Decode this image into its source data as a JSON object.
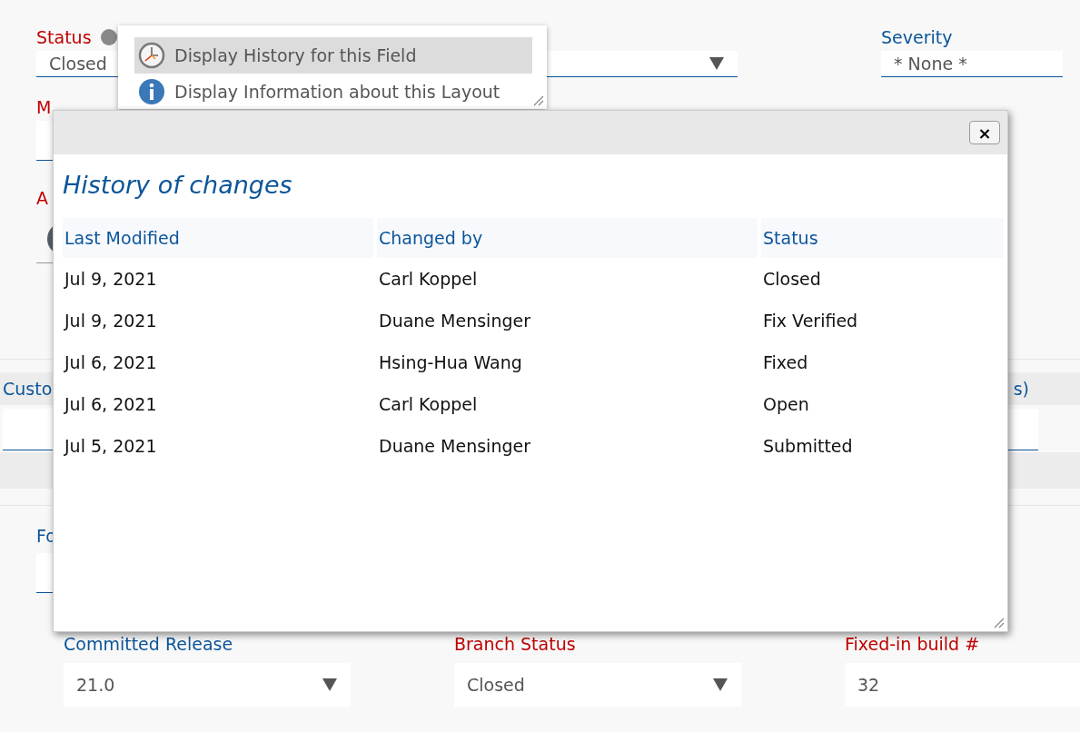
{
  "form": {
    "status": {
      "label": "Status",
      "value": "Closed",
      "required": true
    },
    "severity": {
      "label": "Severity",
      "value": "* None *",
      "required": false
    },
    "field_2": {
      "label": "M",
      "required": true
    },
    "field_3": {
      "label": "A",
      "required": true
    },
    "section": {
      "label": "Custo",
      "label_right": "s)"
    },
    "field_4": {
      "label": "Fo",
      "required": false
    },
    "bottom_fields": [
      {
        "label": "Committed Release",
        "value": "21.0",
        "kind": "dropdown",
        "required": false
      },
      {
        "label": "Branch Status",
        "value": "Closed",
        "kind": "dropdown",
        "required": true
      },
      {
        "label": "Fixed-in build #",
        "value": "32",
        "kind": "text",
        "required": true
      }
    ]
  },
  "context_menu": {
    "items": [
      {
        "label": "Display History for this Field",
        "kind": "history",
        "selected": true
      },
      {
        "label": "Display Information about this Layout",
        "kind": "info",
        "selected": false
      }
    ]
  },
  "dialog": {
    "close": "×",
    "title": "History of changes",
    "columns": [
      "Last Modified",
      "Changed by",
      "Status"
    ],
    "rows": [
      [
        "Jul 9, 2021",
        "Carl Koppel",
        "Closed"
      ],
      [
        "Jul 9, 2021",
        "Duane Mensinger",
        "Fix Verified"
      ],
      [
        "Jul 6, 2021",
        "Hsing-Hua Wang",
        "Fixed"
      ],
      [
        "Jul 6, 2021",
        "Carl Koppel",
        "Open"
      ],
      [
        "Jul 5, 2021",
        "Duane Mensinger",
        "Submitted"
      ]
    ]
  }
}
